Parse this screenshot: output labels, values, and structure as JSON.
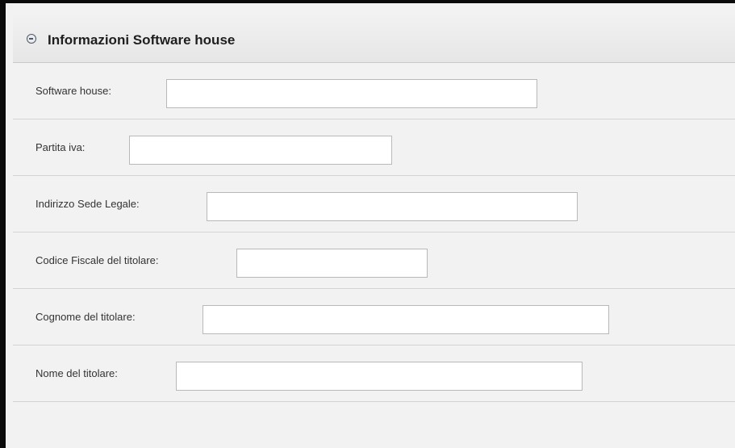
{
  "panel": {
    "title": "Informazioni Software house",
    "collapse_icon": "collapse-minus-circle-icon"
  },
  "fields": [
    {
      "label": "Software house:",
      "value": "",
      "placeholder": ""
    },
    {
      "label": "Partita iva:",
      "value": "",
      "placeholder": ""
    },
    {
      "label": "Indirizzo Sede Legale:",
      "value": "",
      "placeholder": ""
    },
    {
      "label": "Codice Fiscale del titolare:",
      "value": "",
      "placeholder": ""
    },
    {
      "label": "Cognome del titolare:",
      "value": "",
      "placeholder": ""
    },
    {
      "label": "Nome del titolare:",
      "value": "",
      "placeholder": ""
    }
  ],
  "colors": {
    "border": "#0b0b0b",
    "header_bg": "#e9e9e9",
    "body_bg": "#f2f2f2",
    "row_divider": "#d4d4d4",
    "input_border": "#b9b9b9"
  }
}
